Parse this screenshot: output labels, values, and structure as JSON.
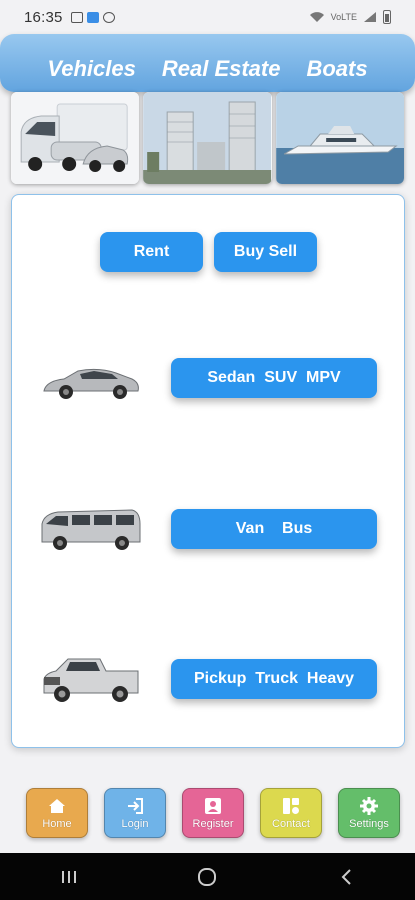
{
  "status_bar": {
    "time": "16:35",
    "network_label": "VoLTE"
  },
  "header": {
    "tabs": [
      {
        "label": "Vehicles"
      },
      {
        "label": "Real Estate"
      },
      {
        "label": "Boats"
      }
    ]
  },
  "categories": [
    {
      "icon": "trucks-image"
    },
    {
      "icon": "buildings-image"
    },
    {
      "icon": "yacht-image"
    }
  ],
  "main": {
    "rent_label": "Rent",
    "buy_sell_label": "Buy Sell",
    "vehicle_types": [
      {
        "label": "Sedan  SUV  MPV",
        "icon": "sedan-image"
      },
      {
        "label": "Van    Bus",
        "icon": "van-image"
      },
      {
        "label": "Pickup  Truck  Heavy",
        "icon": "pickup-image"
      }
    ]
  },
  "bottom_nav": [
    {
      "label": "Home",
      "icon": "home-icon",
      "color": "#e8a94e"
    },
    {
      "label": "Login",
      "icon": "login-icon",
      "color": "#6fb3e8"
    },
    {
      "label": "Register",
      "icon": "register-icon",
      "color": "#e56596"
    },
    {
      "label": "Contact",
      "icon": "contact-icon",
      "color": "#dcd94e"
    },
    {
      "label": "Settings",
      "icon": "gear-icon",
      "color": "#64be6a"
    }
  ],
  "colors": {
    "accent": "#2b95ee",
    "header": "#62a4df"
  }
}
